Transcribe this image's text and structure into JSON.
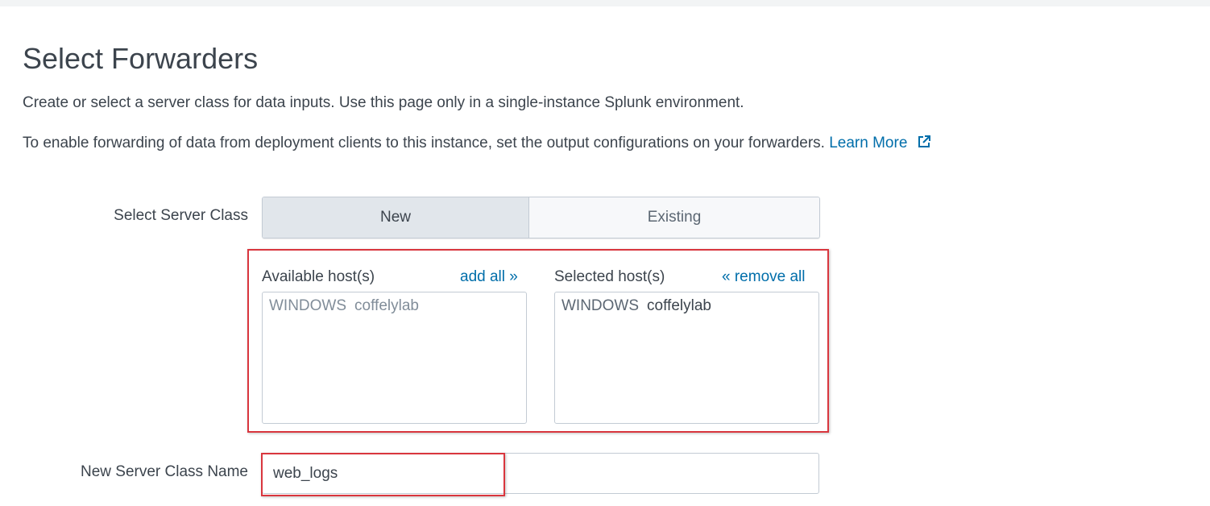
{
  "page": {
    "title": "Select Forwarders",
    "description_line1": "Create or select a server class for data inputs. Use this page only in a single-instance Splunk environment.",
    "description_line2": "To enable forwarding of data from deployment clients to this instance, set the output configurations on your forwarders.",
    "learn_more_link": "Learn More",
    "learn_more_icon": "external-link-icon"
  },
  "server_class": {
    "label": "Select Server Class",
    "options": [
      "New",
      "Existing"
    ],
    "selected": "New"
  },
  "hosts": {
    "available_title": "Available host(s)",
    "add_all_label": "add all »",
    "selected_title": "Selected host(s)",
    "remove_all_label": "« remove all",
    "available": [
      {
        "os": "WINDOWS",
        "name": "coffelylab"
      }
    ],
    "selected": [
      {
        "os": "WINDOWS",
        "name": "coffelylab"
      }
    ]
  },
  "new_server_class": {
    "label": "New Server Class Name",
    "value": "web_logs"
  },
  "colors": {
    "link": "#006eaa",
    "highlight": "#d9363e",
    "toggle_active": "#e1e6eb"
  }
}
